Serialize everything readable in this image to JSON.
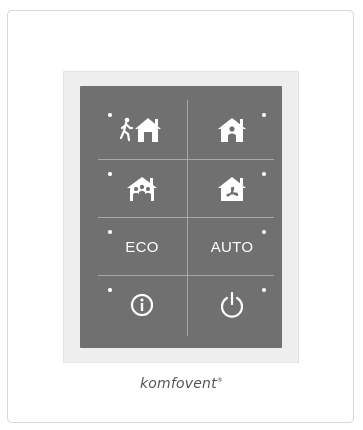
{
  "panel": {
    "buttons": [
      {
        "name": "away-mode",
        "icon": "person-walking-house-icon",
        "label": ""
      },
      {
        "name": "home-mode",
        "icon": "person-in-house-icon",
        "label": ""
      },
      {
        "name": "intensive-mode",
        "icon": "group-in-house-icon",
        "label": ""
      },
      {
        "name": "boost-mode",
        "icon": "fan-in-house-icon",
        "label": ""
      },
      {
        "name": "eco-mode",
        "icon": "",
        "label": "ECO"
      },
      {
        "name": "auto-mode",
        "icon": "",
        "label": "AUTO"
      },
      {
        "name": "info",
        "icon": "info-icon",
        "label": ""
      },
      {
        "name": "power",
        "icon": "power-icon",
        "label": ""
      }
    ],
    "colors": {
      "panel_background": "#707070",
      "icon_color": "#ffffff",
      "divider_color": "#a8a8a8"
    }
  },
  "brand": {
    "text": "komfovent",
    "trademark": "®"
  }
}
